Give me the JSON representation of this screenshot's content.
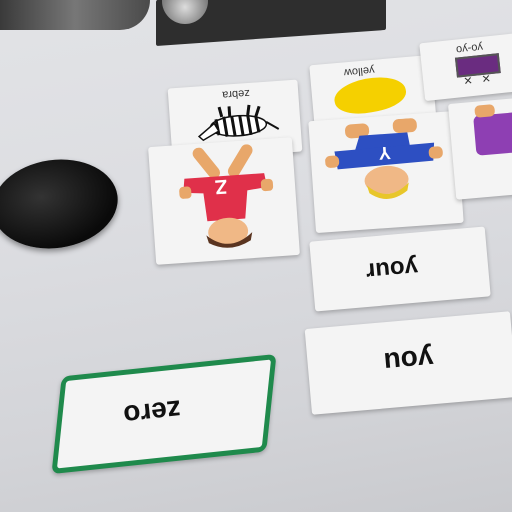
{
  "cards": {
    "zebra": "zebra",
    "yellow": "yellow",
    "yoyo": "yo-yo",
    "your": "your",
    "you": "you",
    "zero": "zero",
    "z_letter": "Z",
    "y_letter": "Y"
  },
  "colors": {
    "table": "#dcdde1",
    "card": "#f4f4f4",
    "zero_border": "#1f8a4c",
    "yellow_blob": "#f5d000",
    "z_shirt": "#e0304a",
    "y_shirt": "#2d4fc2"
  }
}
